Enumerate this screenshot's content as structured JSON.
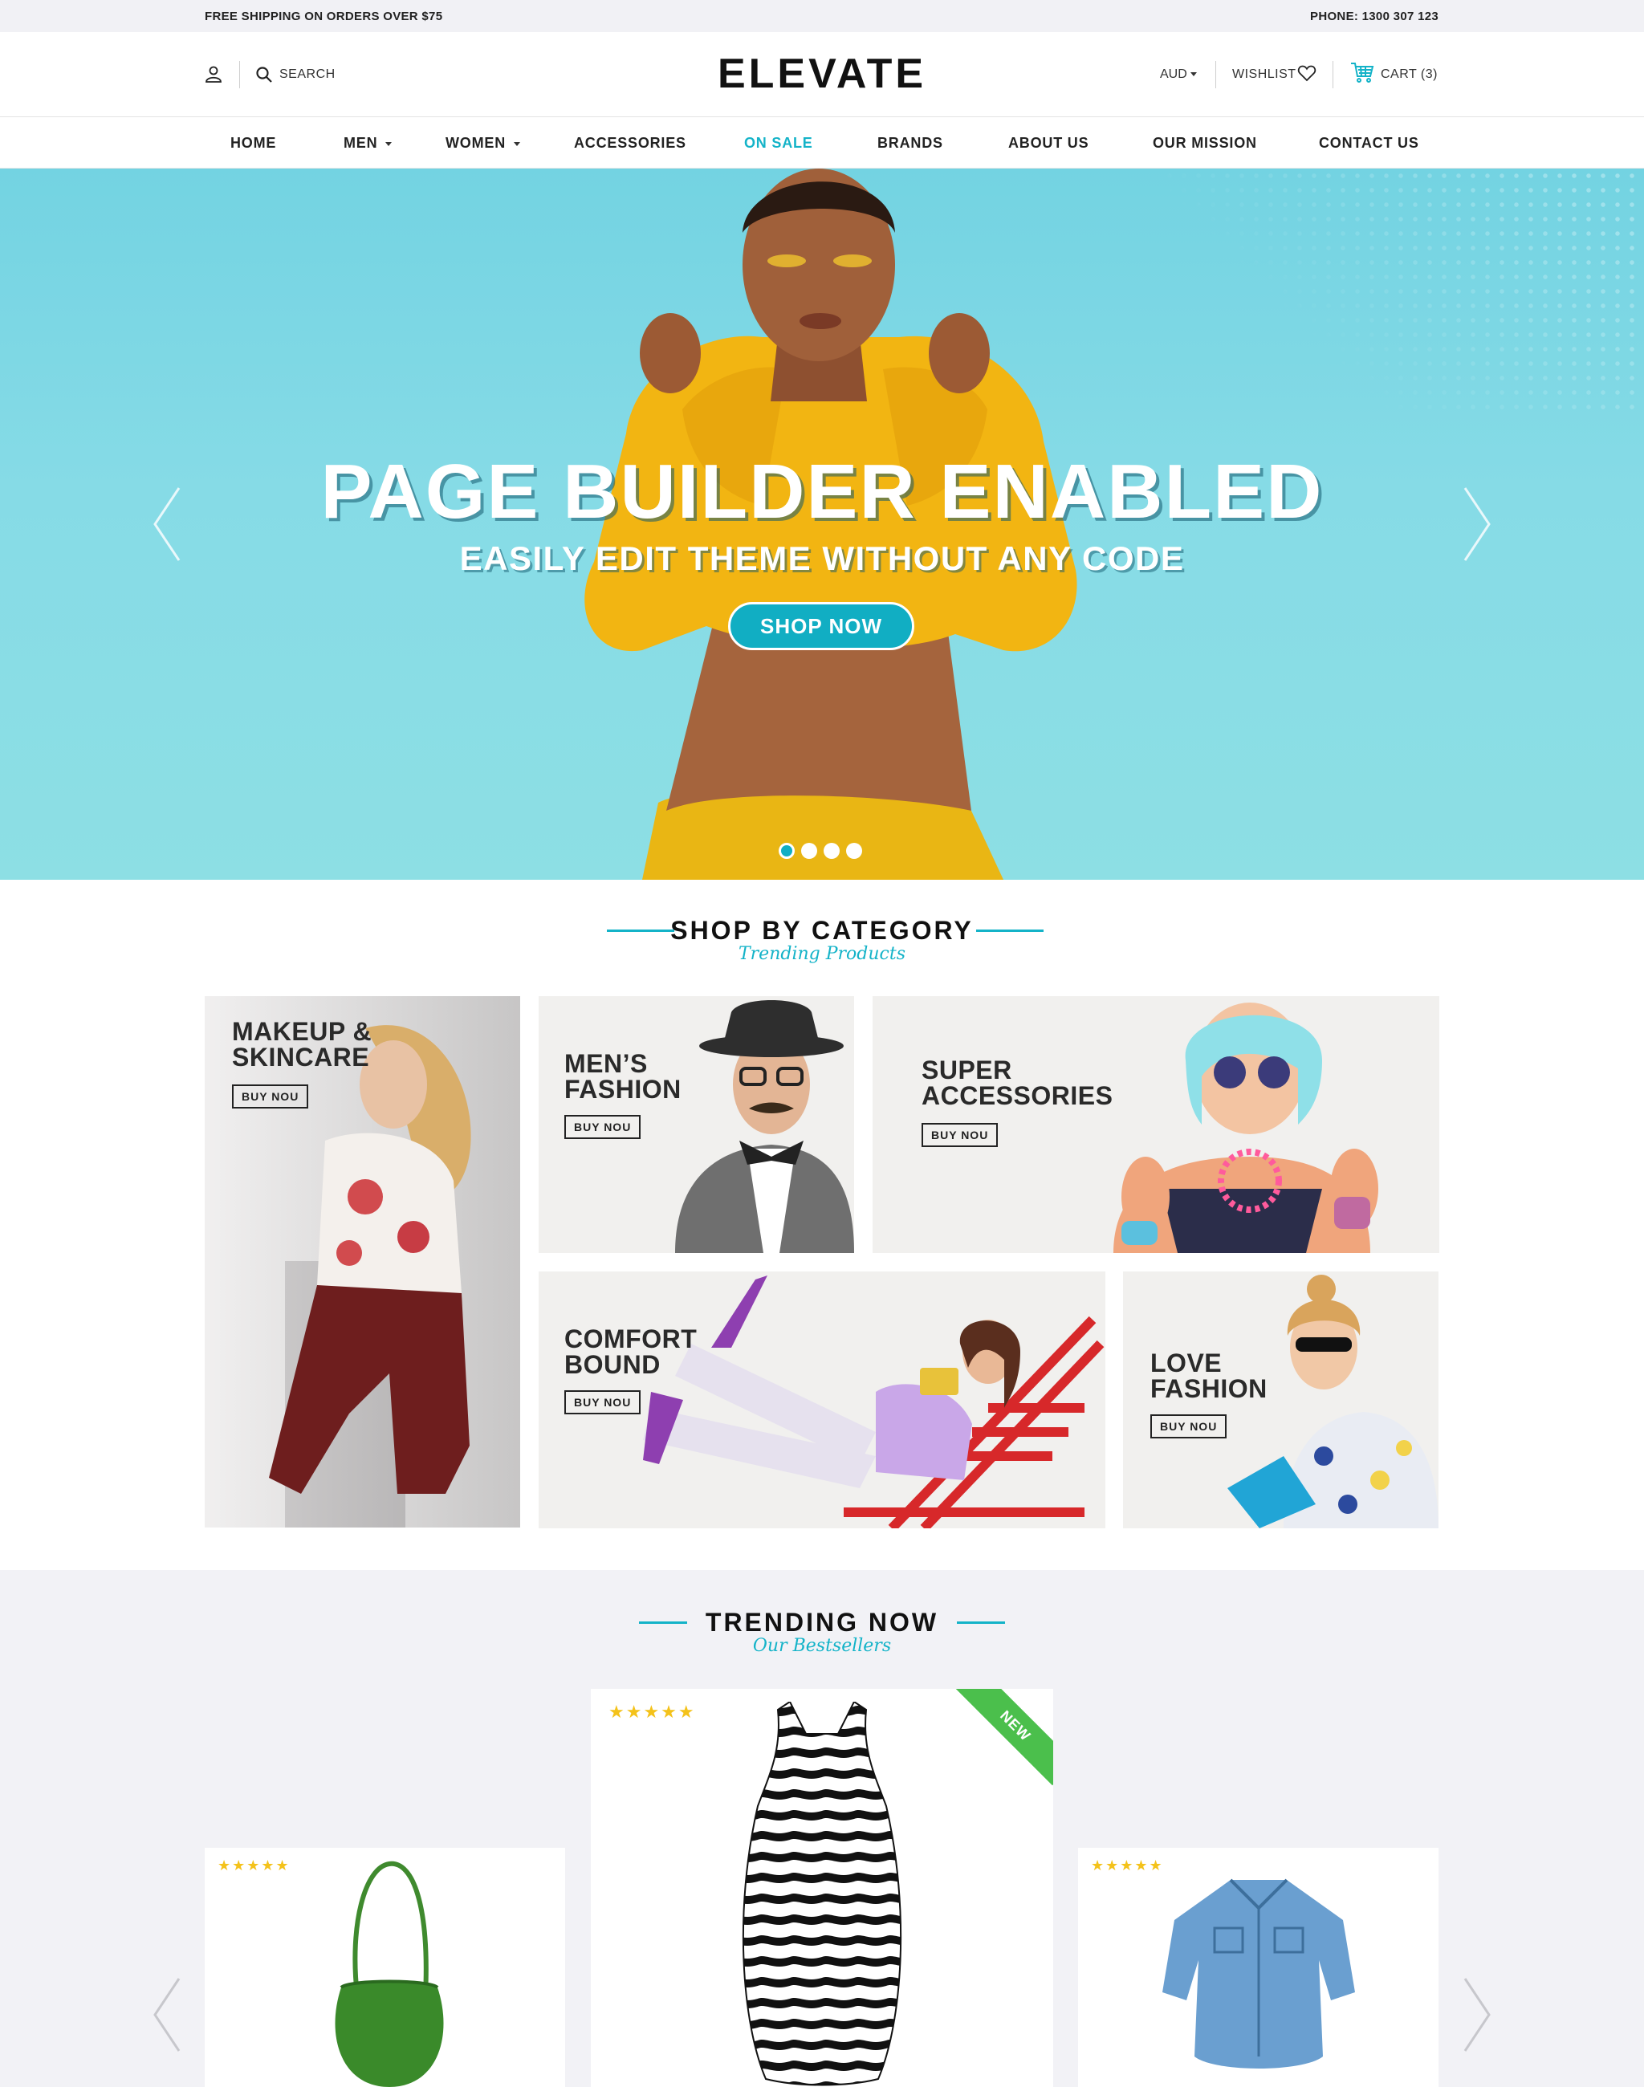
{
  "topbar": {
    "shipping": "FREE SHIPPING ON ORDERS OVER $75",
    "phone": "PHONE: 1300 307 123"
  },
  "header": {
    "search_label": "SEARCH",
    "logo": "ELEVATE",
    "currency": "AUD",
    "wishlist": "WISHLIST",
    "cart": "CART (3)"
  },
  "nav": {
    "items": [
      {
        "label": "HOME"
      },
      {
        "label": "MEN"
      },
      {
        "label": "WOMEN"
      },
      {
        "label": "ACCESSORIES"
      },
      {
        "label": "ON SALE"
      },
      {
        "label": "BRANDS"
      },
      {
        "label": "ABOUT US"
      },
      {
        "label": "OUR MISSION"
      },
      {
        "label": "CONTACT US"
      }
    ]
  },
  "hero": {
    "title": "PAGE BUILDER ENABLED",
    "subtitle": "EASILY EDIT THEME WITHOUT ANY CODE",
    "button": "SHOP NOW",
    "slide_count": 4,
    "active_slide": 1
  },
  "category": {
    "title": "SHOP BY CATEGORY",
    "subtitle": "Trending Products",
    "tiles": [
      {
        "line1": "MAKEUP &",
        "line2": "SKINCARE",
        "button": "BUY NOU"
      },
      {
        "line1": "MEN’S",
        "line2": "FASHION",
        "button": "BUY NOU"
      },
      {
        "line1": "SUPER",
        "line2": "ACCESSORIES",
        "button": "BUY NOU"
      },
      {
        "line1": "COMFORT",
        "line2": "BOUND",
        "button": "BUY NOU"
      },
      {
        "line1": "LOVE",
        "line2": "FASHION",
        "button": "BUY NOU"
      }
    ]
  },
  "trending": {
    "title": "TRENDING NOW",
    "subtitle": "Our Bestsellers",
    "products": [
      {
        "rating": 5,
        "stars": "★★★★★",
        "badge": ""
      },
      {
        "rating": 5,
        "stars": "★★★★★",
        "badge": "NEW"
      },
      {
        "rating": 5,
        "stars": "★★★★★",
        "badge": ""
      }
    ]
  },
  "colors": {
    "accent": "#14b3c8",
    "star": "#f4c21a",
    "badge": "#4bbf4c",
    "hero_bg": "#7fd8e4"
  }
}
